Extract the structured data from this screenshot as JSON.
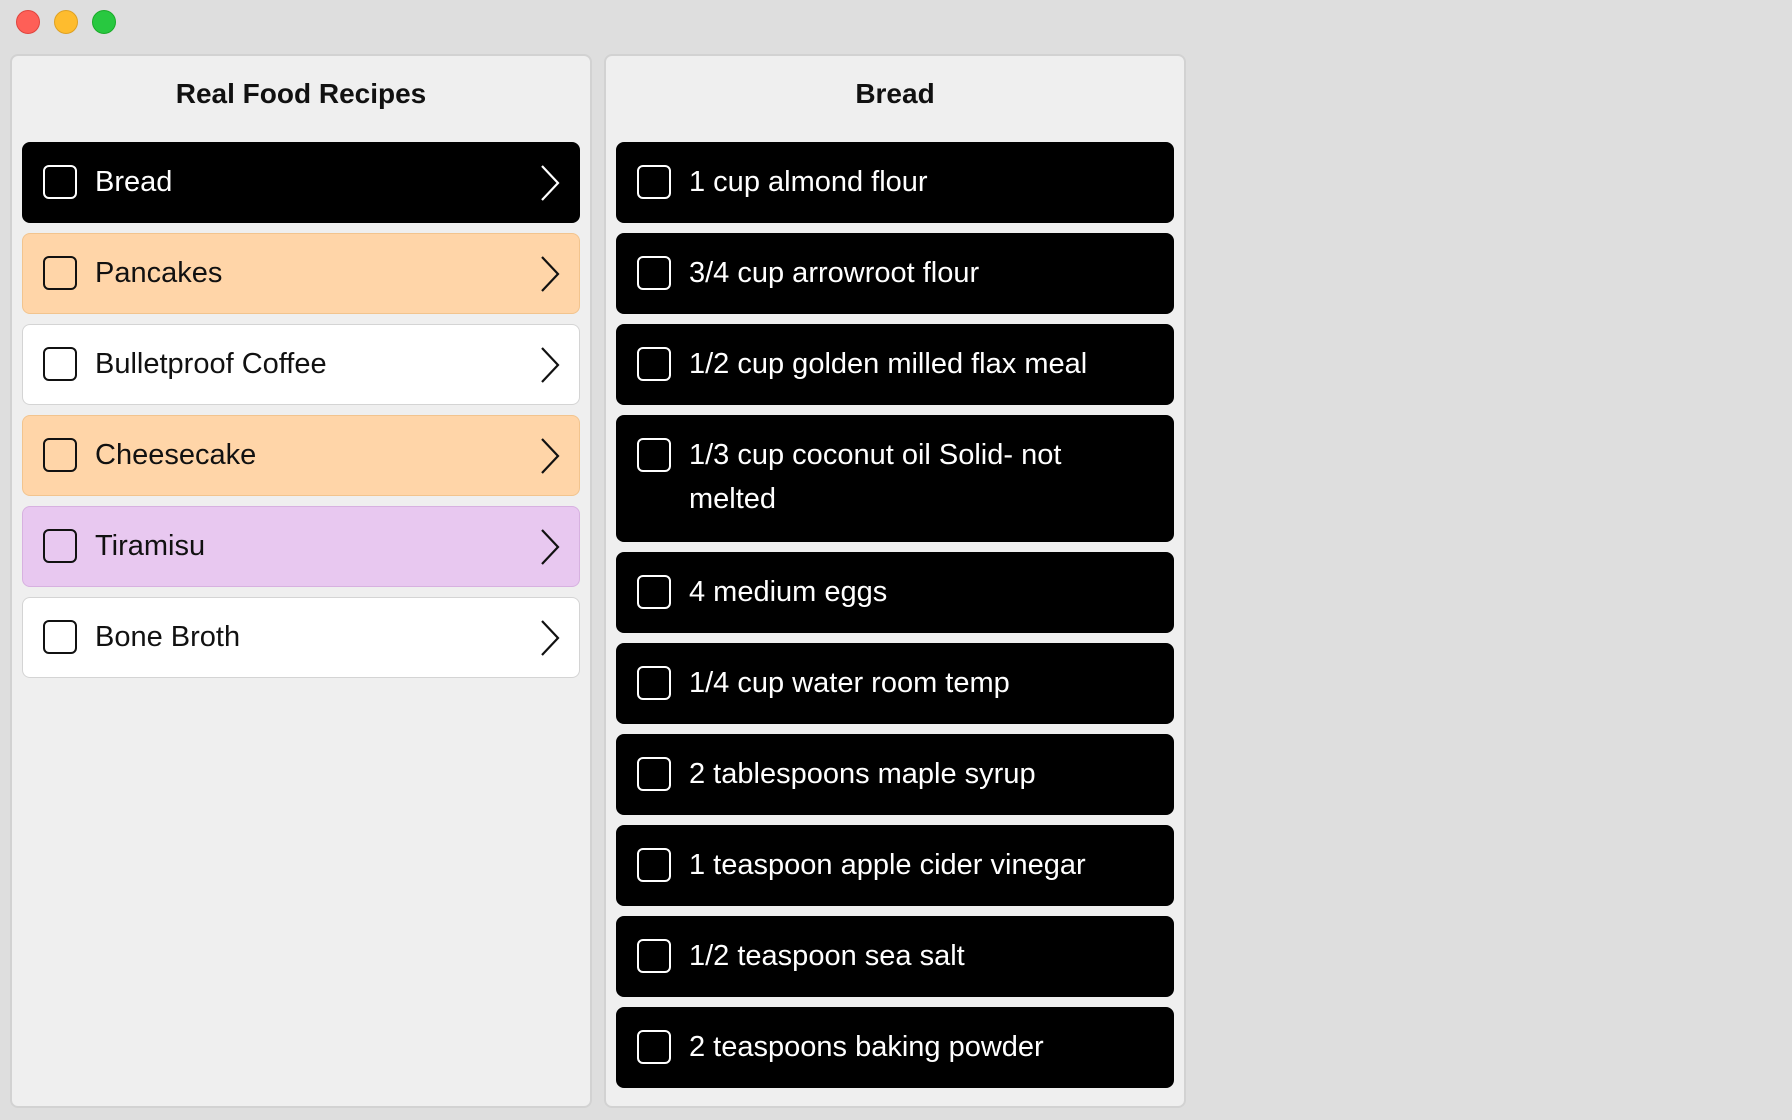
{
  "recipes_column": {
    "title": "Real Food Recipes",
    "items": [
      {
        "label": "Bread",
        "style": "black"
      },
      {
        "label": "Pancakes",
        "style": "orange"
      },
      {
        "label": "Bulletproof Coffee",
        "style": "white"
      },
      {
        "label": "Cheesecake",
        "style": "orange"
      },
      {
        "label": "Tiramisu",
        "style": "purple"
      },
      {
        "label": "Bone Broth",
        "style": "white"
      }
    ]
  },
  "ingredients_column": {
    "title": "Bread",
    "items": [
      {
        "label": "1 cup almond flour"
      },
      {
        "label": "3/4 cup arrowroot flour"
      },
      {
        "label": "1/2 cup golden milled flax meal"
      },
      {
        "label": "1/3 cup coconut oil Solid- not melted"
      },
      {
        "label": "4 medium eggs"
      },
      {
        "label": "1/4 cup water room temp"
      },
      {
        "label": "2 tablespoons maple syrup"
      },
      {
        "label": "1 teaspoon apple cider vinegar"
      },
      {
        "label": "1/2 teaspoon sea salt"
      },
      {
        "label": "2 teaspoons baking powder"
      }
    ]
  },
  "colors": {
    "selected": "#000000",
    "orange": "#ffd5a8",
    "purple": "#e8c8f0",
    "white": "#ffffff"
  },
  "icons": {
    "row_disclosure": "chevron-right-icon",
    "row_check": "checkbox-icon"
  }
}
